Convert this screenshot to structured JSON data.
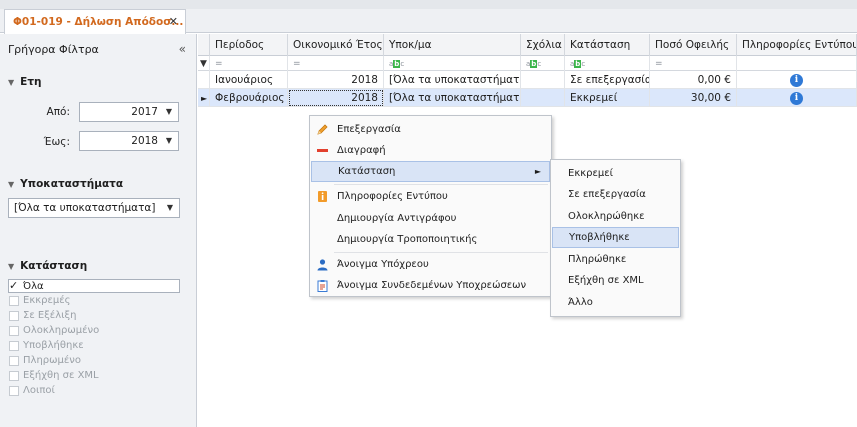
{
  "tab": {
    "title": "Φ01-019 - Δήλωση Απόδοσ...",
    "close": "✕"
  },
  "filters": {
    "header": "Γρήγορα Φίλτρα",
    "collapse": "«",
    "years": {
      "title": "Ετη",
      "from_label": "Από:",
      "from_value": "2017",
      "to_label": "Έως:",
      "to_value": "2018"
    },
    "branches": {
      "title": "Υποκαταστήματα",
      "value": "[Όλα τα υποκαταστήματα]"
    },
    "status": {
      "title": "Κατάσταση",
      "options": [
        {
          "label": "Όλα",
          "checked": true
        },
        {
          "label": "Εκκρεμές",
          "checked": false
        },
        {
          "label": "Σε Εξέλιξη",
          "checked": false
        },
        {
          "label": "Ολοκληρωμένο",
          "checked": false
        },
        {
          "label": "Υποβλήθηκε",
          "checked": false
        },
        {
          "label": "Πληρωμένο",
          "checked": false
        },
        {
          "label": "Εξήχθη σε XML",
          "checked": false
        },
        {
          "label": "Λοιποί",
          "checked": false
        }
      ]
    }
  },
  "grid": {
    "columns": [
      "Περίοδος",
      "Οικονομικό Έτος",
      "Υποκ/μα",
      "Σχόλια",
      "Κατάσταση",
      "Ποσό Οφειλής",
      "Πληροφορίες Εντύπου"
    ],
    "filter_row": {
      "eq": "=",
      "abc": "abc"
    },
    "rows": [
      {
        "period": "Ιανουάριος",
        "year": "2018",
        "branch": "[Όλα τα υποκαταστήματα]",
        "comments": "",
        "status": "Σε επεξεργασία",
        "amount": "0,00 €"
      },
      {
        "period": "Φεβρουάριος",
        "year": "2018",
        "branch": "[Όλα τα υποκαταστήματα]",
        "comments": "",
        "status": "Εκκρεμεί",
        "amount": "30,00 €"
      }
    ]
  },
  "context_menu": {
    "items": [
      {
        "label": "Επεξεργασία",
        "icon": "pencil-icon"
      },
      {
        "label": "Διαγραφή",
        "icon": "delete-icon"
      },
      {
        "label": "Κατάσταση",
        "icon": "",
        "submenu_arrow": "►"
      },
      {
        "label": "Πληροφορίες Εντύπου",
        "icon": "info-book-icon"
      },
      {
        "label": "Δημιουργία Αντιγράφου",
        "icon": ""
      },
      {
        "label": "Δημιουργία Τροποποιητικής",
        "icon": ""
      },
      {
        "label": "Άνοιγμα Υπόχρεου",
        "icon": "person-icon"
      },
      {
        "label": "Άνοιγμα Συνδεδεμένων Υποχρεώσεων",
        "icon": "clipboard-icon"
      }
    ]
  },
  "status_submenu": {
    "items": [
      "Εκκρεμεί",
      "Σε επεξεργασία",
      "Ολοκληρώθηκε",
      "Υποβλήθηκε",
      "Πληρώθηκε",
      "Εξήχθη σε XML",
      "Άλλο"
    ],
    "highlighted": "Υποβλήθηκε"
  },
  "colors": {
    "tab_title": "#d2691e",
    "selection": "#dbe7fb",
    "highlight": "#d9e4f6",
    "info_icon": "#2f79d6"
  }
}
